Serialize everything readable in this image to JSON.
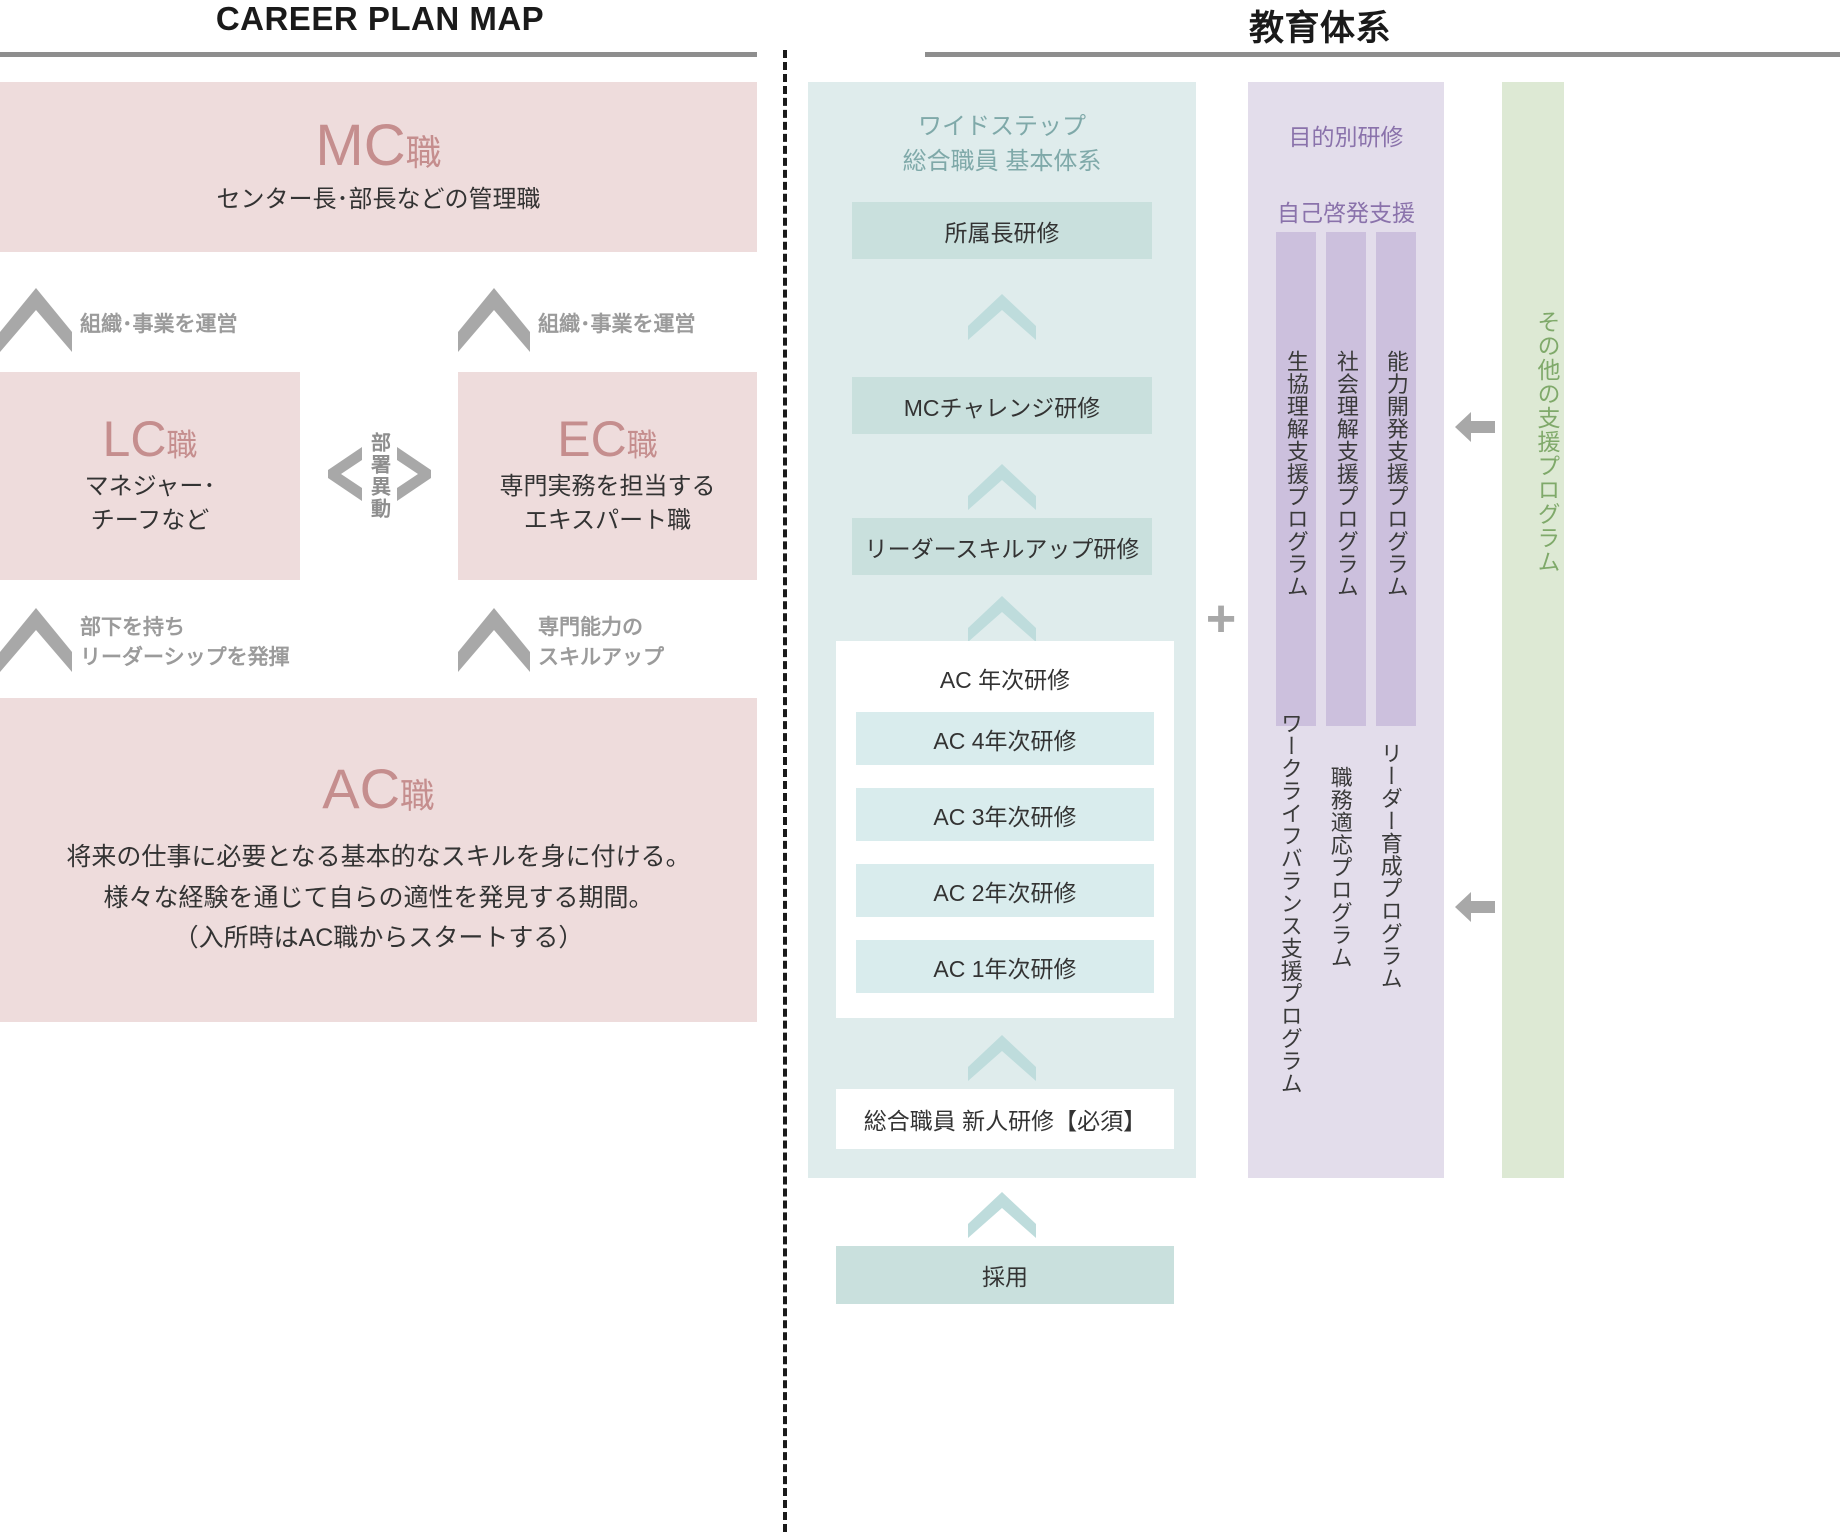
{
  "titles": {
    "left": "CAREER PLAN MAP",
    "right": "教育体系"
  },
  "career_map": {
    "mc": {
      "name": "MC",
      "suffix": "職",
      "description": "センター長･部長などの管理職"
    },
    "lc": {
      "name": "LC",
      "suffix": "職",
      "description": "マネジャー･\nチーフなど"
    },
    "ec": {
      "name": "EC",
      "suffix": "職",
      "description": "専門実務を担当する\nエキスパート職"
    },
    "ac": {
      "name": "AC",
      "suffix": "職",
      "description": "将来の仕事に必要となる基本的なスキルを身に付ける。\n様々な経験を通じて自らの適性を発見する期間。\n（入所時はAC職からスタートする）"
    },
    "transfer_label": "部署異動",
    "step_labels": {
      "lc_to_mc": "組織･事業を運営",
      "ec_to_mc": "組織･事業を運営",
      "ac_to_lc": "部下を持ち\nリーダーシップを発揮",
      "ac_to_ec": "専門能力の\nスキルアップ"
    }
  },
  "education": {
    "wide_step": {
      "heading": "ワイドステップ\n総合職員 基本体系",
      "steps": [
        "所属長研修",
        "MCチャレンジ研修",
        "リーダースキルアップ研修"
      ],
      "ac_group": {
        "title": "AC  年次研修",
        "items": [
          "AC  4年次研修",
          "AC  3年次研修",
          "AC  2年次研修",
          "AC  1年次研修"
        ]
      },
      "newcomer": "総合職員 新人研修【必須】",
      "entry": "採用"
    },
    "plus": "+",
    "purpose_training": {
      "heading": "目的別研修",
      "subheading": "自己啓発支援",
      "self_dev_programs": [
        "生協理解支援プログラム",
        "社会理解支援プログラム",
        "能力開発支援プログラム"
      ],
      "other_programs": [
        "ワークライフバランス支援プログラム",
        "職務適応プログラム",
        "リーダー育成プログラム"
      ]
    },
    "other_support": {
      "label": "その他の支援プログラム"
    }
  },
  "colors": {
    "pink_box": "#eedcdc",
    "pink_text": "#c58e8e",
    "teal_panel": "#dfecec",
    "teal_box": "#c9e0dd",
    "teal_text": "#7fa9a9",
    "purple_panel": "#e3ddeb",
    "purple_bar": "#ccc0dd",
    "purple_text": "#8a72ab",
    "green_panel": "#dde9d4",
    "green_text": "#7fa96a",
    "gray_arrow": "#a8a8a8"
  }
}
